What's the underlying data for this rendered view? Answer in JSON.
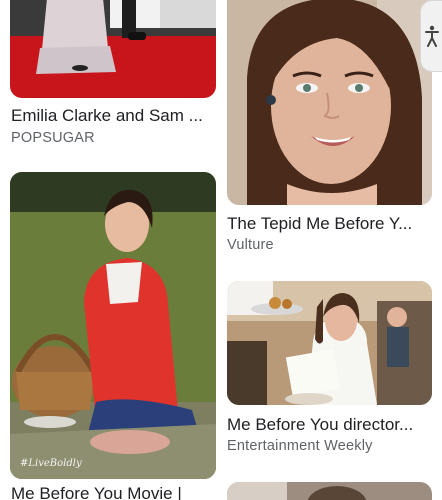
{
  "results": [
    {
      "title": "Emilia Clarke and Sam ...",
      "source": "POPSUGAR"
    },
    {
      "title": "The Tepid Me Before Y...",
      "source": "Vulture"
    },
    {
      "title": "Me Before You Movie |",
      "source": "",
      "watermark": "#LiveBoldly"
    },
    {
      "title": "Me Before You director...",
      "source": "Entertainment Weekly"
    }
  ],
  "accessibility": {
    "icon": "accessibility-person-icon"
  }
}
